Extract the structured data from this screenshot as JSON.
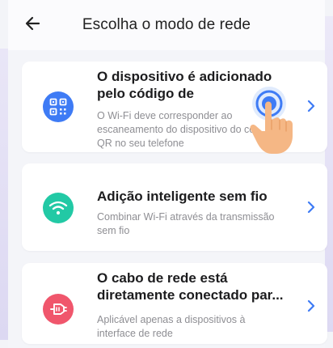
{
  "header": {
    "title": "Escolha o modo de rede",
    "back_icon": "arrow-left-icon"
  },
  "options": [
    {
      "title_line1": "O dispositivo é adicionado",
      "title_line2": "pelo código de",
      "desc_line1": "O Wi-Fi deve corresponder ao",
      "desc_line2": "escaneamento do dispositivo do có",
      "desc_line3": "QR no seu telefone",
      "icon": "qr-code-icon",
      "color": "#3e7bf5"
    },
    {
      "title_line1": "Adição inteligente sem fio",
      "desc_line1": "Combinar Wi-Fi através da transmissão",
      "desc_line2": "sem fio",
      "icon": "wifi-icon",
      "color": "#22c9a5"
    },
    {
      "title_line1": "O cabo de rede está",
      "title_line2": "diretamente conectado par...",
      "desc_line1": "Aplicável apenas a dispositivos à",
      "desc_line2": "interface de rede",
      "icon": "ethernet-cable-icon",
      "color": "#f0566c"
    }
  ],
  "colors": {
    "accent_blue": "#3e7bf5",
    "chevron": "#3e7bf5",
    "finger": "#f5b785"
  }
}
